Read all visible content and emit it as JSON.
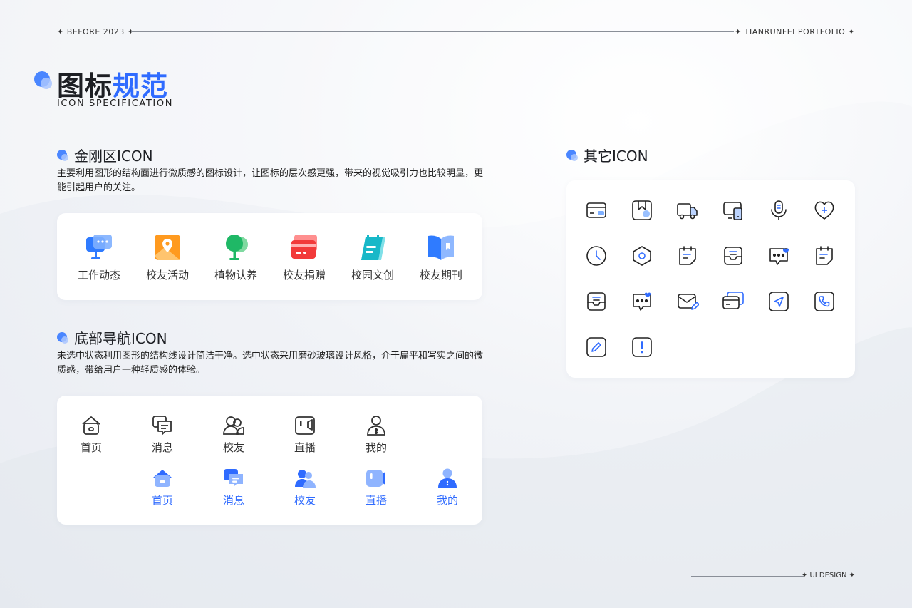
{
  "header": {
    "left_label": "BEFORE 2023",
    "right_label": "TIANRUNFEI  PORTFOLIO"
  },
  "footer": {
    "label": "UI DESIGN"
  },
  "title": {
    "part1": "图标",
    "part2": "规范",
    "subtitle": "ICON SPECIFICATION"
  },
  "section_kingkong": {
    "heading": "金刚区ICON",
    "description": "主要利用图形的结构面进行微质感的图标设计，让图标的层次感更强，带来的视觉吸引力也比较明显，更能引起用户的关注。",
    "items": [
      {
        "label": "工作动态",
        "icon": "work-news-icon"
      },
      {
        "label": "校友活动",
        "icon": "alumni-activity-icon"
      },
      {
        "label": "植物认养",
        "icon": "plant-adopt-icon"
      },
      {
        "label": "校友捐赠",
        "icon": "alumni-donation-icon"
      },
      {
        "label": "校园文创",
        "icon": "campus-creative-icon"
      },
      {
        "label": "校友期刊",
        "icon": "alumni-journal-icon"
      }
    ]
  },
  "section_nav": {
    "heading": "底部导航ICON",
    "description": "未选中状态利用图形的结构线设计简洁干净。选中状态采用磨砂玻璃设计风格，介于扁平和写实之间的微质感，带给用户一种轻质感的体验。",
    "unselected": [
      {
        "label": "首页",
        "icon": "home-icon"
      },
      {
        "label": "消息",
        "icon": "message-icon"
      },
      {
        "label": "校友",
        "icon": "alumni-icon"
      },
      {
        "label": "直播",
        "icon": "live-icon"
      },
      {
        "label": "我的",
        "icon": "profile-icon"
      }
    ],
    "selected": [
      {
        "label": "首页",
        "icon": "home-filled-icon"
      },
      {
        "label": "消息",
        "icon": "message-filled-icon"
      },
      {
        "label": "校友",
        "icon": "alumni-filled-icon"
      },
      {
        "label": "直播",
        "icon": "live-filled-icon"
      },
      {
        "label": "我的",
        "icon": "profile-filled-icon"
      }
    ]
  },
  "section_other": {
    "heading": "其它ICON",
    "icons": [
      "card-icon",
      "bookmark-icon",
      "truck-icon",
      "devices-icon",
      "microphone-icon",
      "heart-plus-icon",
      "clock-icon",
      "hexagon-settings-icon",
      "note-icon",
      "inbox-icon",
      "chat-heart-icon",
      "note-alt-icon",
      "inbox-alt-icon",
      "chat-heart-alt-icon",
      "mail-edit-icon",
      "cards-icon",
      "send-icon",
      "phone-icon",
      "edit-icon",
      "alert-icon"
    ]
  },
  "colors": {
    "accent": "#2f6bff",
    "text": "#1d1f24",
    "card": "#ffffff"
  }
}
